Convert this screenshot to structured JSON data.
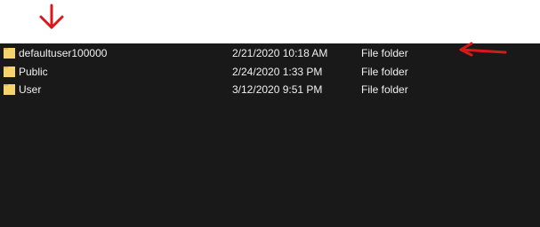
{
  "file_list": {
    "rows": [
      {
        "name": "defaultuser100000",
        "date_modified": "2/21/2020 10:18 AM",
        "type": "File folder",
        "icon": "folder-icon"
      },
      {
        "name": "Public",
        "date_modified": "2/24/2020 1:33 PM",
        "type": "File folder",
        "icon": "folder-icon"
      },
      {
        "name": "User",
        "date_modified": "3/12/2020 9:51 PM",
        "type": "File folder",
        "icon": "folder-icon"
      }
    ]
  },
  "annotations": {
    "down_arrow": {
      "icon": "arrow-down-icon",
      "color": "#d7191c"
    },
    "left_arrow": {
      "icon": "arrow-left-icon",
      "color": "#d7191c"
    }
  },
  "colors": {
    "background": "#191919",
    "text": "#f0f0f0",
    "folder": "#f7d36c",
    "annotation": "#d7191c"
  }
}
